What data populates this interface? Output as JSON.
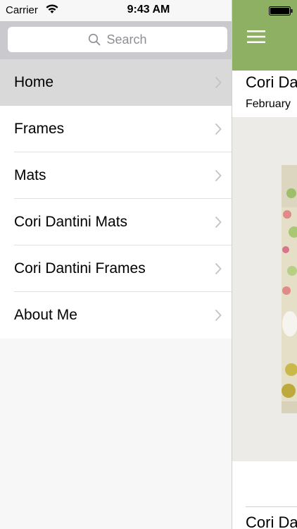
{
  "status_bar": {
    "carrier": "Carrier",
    "time": "9:43 AM"
  },
  "search": {
    "placeholder": "Search"
  },
  "menu": {
    "items": [
      {
        "label": "Home",
        "selected": true
      },
      {
        "label": "Frames",
        "selected": false
      },
      {
        "label": "Mats",
        "selected": false
      },
      {
        "label": "Cori Dantini Mats",
        "selected": false
      },
      {
        "label": "Cori Dantini Frames",
        "selected": false
      },
      {
        "label": "About Me",
        "selected": false
      }
    ]
  },
  "content": {
    "post_title": "Cori Da",
    "post_date": "February",
    "next_post_title": "Cori Da"
  },
  "colors": {
    "navbar": "#8db063",
    "search_bar_bg": "#c9c9ce",
    "selected_row": "#d9d9d9",
    "image_panel": "#ecebe8"
  },
  "icons": {
    "wifi": "wifi-icon",
    "battery": "battery-icon",
    "search": "search-icon",
    "chevron": "chevron-right-icon",
    "hamburger": "hamburger-menu-icon"
  }
}
